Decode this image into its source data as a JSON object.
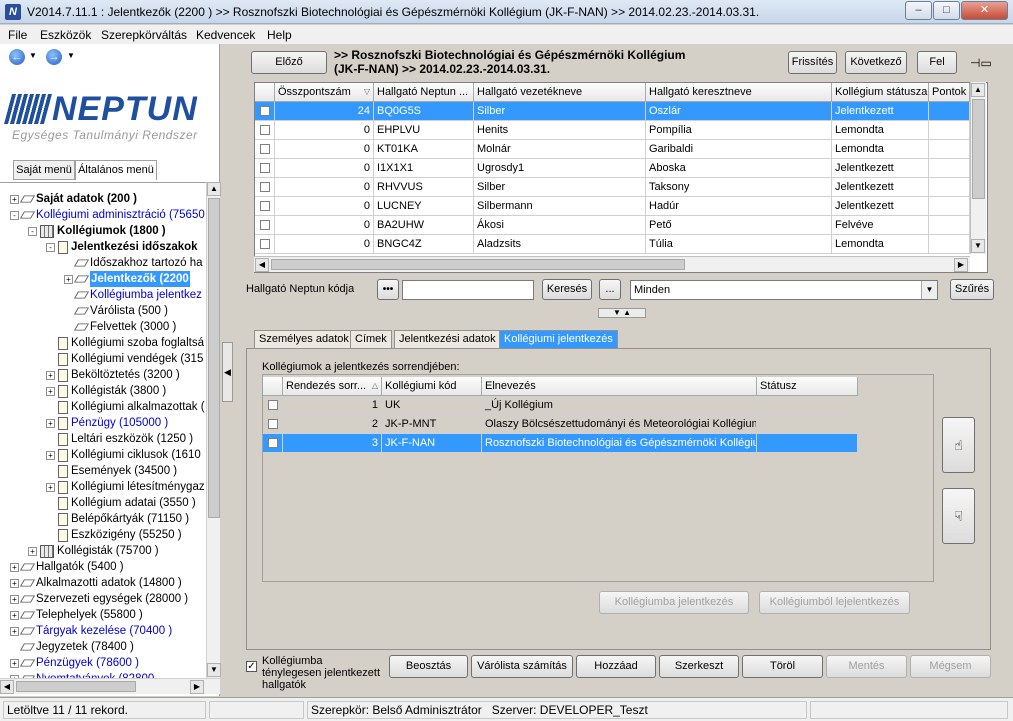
{
  "window": {
    "title": "V2014.7.11.1 : Jelentkezők (2200  ) >> Rosznofszki Biotechnológiai és Gépészmérnöki Kollégium (JK-F-NAN) >> 2014.02.23.-2014.03.31."
  },
  "menu": [
    "File",
    "Eszközök",
    "Szerepkörváltás",
    "Kedvencek",
    "Help"
  ],
  "logo": {
    "word": "NEPTUN",
    "subtitle": "Egységes Tanulmányi Rendszer"
  },
  "left_tabs": [
    "Saját menü",
    "Általános menü"
  ],
  "tree": [
    {
      "label": "Saját adatok (200  )",
      "level": 0,
      "exp": "+",
      "icon": "diamond",
      "style": "bold"
    },
    {
      "label": "Kollégiumi adminisztráció (75650",
      "level": 0,
      "exp": "-",
      "icon": "diamond",
      "style": "blue"
    },
    {
      "label": "Kollégiumok (1800  )",
      "level": 1,
      "exp": "-",
      "icon": "building",
      "style": "bold"
    },
    {
      "label": "Jelentkezési időszakok",
      "level": 2,
      "exp": "-",
      "icon": "doc",
      "style": "bold"
    },
    {
      "label": "Időszakhoz tartozó ha",
      "level": 3,
      "exp": "",
      "icon": "diamond",
      "style": ""
    },
    {
      "label": "Jelentkezők (2200",
      "level": 3,
      "exp": "+",
      "icon": "diamond",
      "style": "sel"
    },
    {
      "label": "Kollégiumba jelentkez",
      "level": 3,
      "exp": "",
      "icon": "diamond",
      "style": "blue"
    },
    {
      "label": "Várólista (500  )",
      "level": 3,
      "exp": "",
      "icon": "diamond",
      "style": ""
    },
    {
      "label": "Felvettek (3000  )",
      "level": 3,
      "exp": "",
      "icon": "diamond",
      "style": ""
    },
    {
      "label": "Kollégiumi szoba foglaltsá",
      "level": 2,
      "exp": "",
      "icon": "doc",
      "style": ""
    },
    {
      "label": "Kollégiumi vendégek (315",
      "level": 2,
      "exp": "",
      "icon": "doc",
      "style": ""
    },
    {
      "label": "Beköltöztetés (3200  )",
      "level": 2,
      "exp": "+",
      "icon": "doc",
      "style": ""
    },
    {
      "label": "Kollégisták (3800  )",
      "level": 2,
      "exp": "+",
      "icon": "doc",
      "style": ""
    },
    {
      "label": "Kollégiumi alkalmazottak (",
      "level": 2,
      "exp": "",
      "icon": "doc",
      "style": ""
    },
    {
      "label": "Pénzügy (105000  )",
      "level": 2,
      "exp": "+",
      "icon": "doc",
      "style": "blue"
    },
    {
      "label": "Leltári eszközök (1250  )",
      "level": 2,
      "exp": "",
      "icon": "doc",
      "style": ""
    },
    {
      "label": "Kollégiumi ciklusok (1610",
      "level": 2,
      "exp": "+",
      "icon": "doc",
      "style": ""
    },
    {
      "label": "Események (34500  )",
      "level": 2,
      "exp": "",
      "icon": "doc",
      "style": ""
    },
    {
      "label": "Kollégiumi létesítménygaz",
      "level": 2,
      "exp": "+",
      "icon": "doc",
      "style": ""
    },
    {
      "label": "Kollégium adatai (3550  )",
      "level": 2,
      "exp": "",
      "icon": "doc",
      "style": ""
    },
    {
      "label": "Belépőkártyák (71150  )",
      "level": 2,
      "exp": "",
      "icon": "doc",
      "style": ""
    },
    {
      "label": "Eszközigény (55250  )",
      "level": 2,
      "exp": "",
      "icon": "doc",
      "style": ""
    },
    {
      "label": "Kollégisták (75700  )",
      "level": 1,
      "exp": "+",
      "icon": "building",
      "style": ""
    },
    {
      "label": "Hallgatók (5400  )",
      "level": 0,
      "exp": "+",
      "icon": "diamond",
      "style": ""
    },
    {
      "label": "Alkalmazotti adatok (14800  )",
      "level": 0,
      "exp": "+",
      "icon": "diamond",
      "style": ""
    },
    {
      "label": "Szervezeti egységek (28000  )",
      "level": 0,
      "exp": "+",
      "icon": "diamond",
      "style": ""
    },
    {
      "label": "Telephelyek (55800  )",
      "level": 0,
      "exp": "+",
      "icon": "diamond",
      "style": ""
    },
    {
      "label": "Tárgyak kezelése (70400  )",
      "level": 0,
      "exp": "+",
      "icon": "diamond",
      "style": "blue"
    },
    {
      "label": "Jegyzetek (78400  )",
      "level": 0,
      "exp": "",
      "icon": "diamond",
      "style": ""
    },
    {
      "label": "Pénzügyek (78600  )",
      "level": 0,
      "exp": "+",
      "icon": "diamond",
      "style": "blue"
    },
    {
      "label": "Nyomtatványok (82800",
      "level": 0,
      "exp": "+",
      "icon": "diamond",
      "style": "blue"
    }
  ],
  "header": {
    "prev": "Előző",
    "title_line1": ">> Rosznofszki Biotechnológiai és Gépészmérnöki Kollégium",
    "title_line2": "(JK-F-NAN) >> 2014.02.23.-2014.03.31.",
    "refresh": "Frissítés",
    "next": "Következő",
    "up": "Fel"
  },
  "grid1": {
    "columns": [
      "",
      "Összpontszám",
      "Hallgató Neptun ...",
      "Hallgató vezetékneve",
      "Hallgató keresztneve",
      "Kollégium státusza",
      "Pontok"
    ],
    "rows": [
      [
        "",
        "24",
        "BQ0G5S",
        "Silber",
        "Oszlár",
        "Jelentkezett",
        ""
      ],
      [
        "",
        "0",
        "EHPLVU",
        "Henits",
        "Pompília",
        "Lemondta",
        ""
      ],
      [
        "",
        "0",
        "KT01KA",
        "Molnár",
        "Garibaldi",
        "Lemondta",
        ""
      ],
      [
        "",
        "0",
        "I1X1X1",
        "Ugrosdy1",
        "Aboska",
        "Jelentkezett",
        ""
      ],
      [
        "",
        "0",
        "RHVVUS",
        "Silber",
        "Taksony",
        "Jelentkezett",
        ""
      ],
      [
        "",
        "0",
        "LUCNEY",
        "Silbermann",
        "Hadúr",
        "Jelentkezett",
        ""
      ],
      [
        "",
        "0",
        "BA2UHW",
        "Ákosi",
        "Pető",
        "Felvéve",
        ""
      ],
      [
        "",
        "0",
        "BNGC4Z",
        "Aladzsits",
        "Túlia",
        "Lemondta",
        ""
      ]
    ]
  },
  "filter": {
    "label": "Hallgató Neptun kódja",
    "dots": "•••",
    "value": "",
    "search": "Keresés",
    "more": "...",
    "select": "Minden",
    "apply": "Szűrés"
  },
  "tabs": [
    "Személyes adatok",
    "Címek",
    "Jelentkezési adatok",
    "Kollégiumi jelentkezés"
  ],
  "sub_label": "Kollégiumok a jelentkezés sorrendjében:",
  "grid2": {
    "columns": [
      "",
      "Rendezés sorr...",
      "Kollégiumi kód",
      "Elnevezés",
      "Státusz"
    ],
    "rows": [
      [
        "",
        "1",
        "UK",
        "_Új Kollégium",
        ""
      ],
      [
        "",
        "2",
        "JK-P-MNT",
        "Olaszy Bölcsészettudományi és Meteorológiai Kollégium",
        ""
      ],
      [
        "",
        "3",
        "JK-F-NAN",
        "Rosznofszki Biotechnológiai és Gépészmérnöki Kollégium",
        ""
      ]
    ]
  },
  "panel_buttons": {
    "register": "Kollégiumba jelentkezés",
    "unregister": "Kollégiumból lejelentkezés"
  },
  "bottom": {
    "checkbox_label": "Kollégiumba ténylegesen jelentkezett hallgatók",
    "buttons": [
      "Beosztás",
      "Várólista számítás",
      "Hozzáad",
      "Szerkeszt",
      "Töröl",
      "Mentés",
      "Mégsem"
    ]
  },
  "status": {
    "loaded": "Letöltve 11 / 11 rekord.",
    "role": "Szerepkör: Belső Adminisztrátor",
    "server": "Szerver: DEVELOPER_Teszt"
  }
}
